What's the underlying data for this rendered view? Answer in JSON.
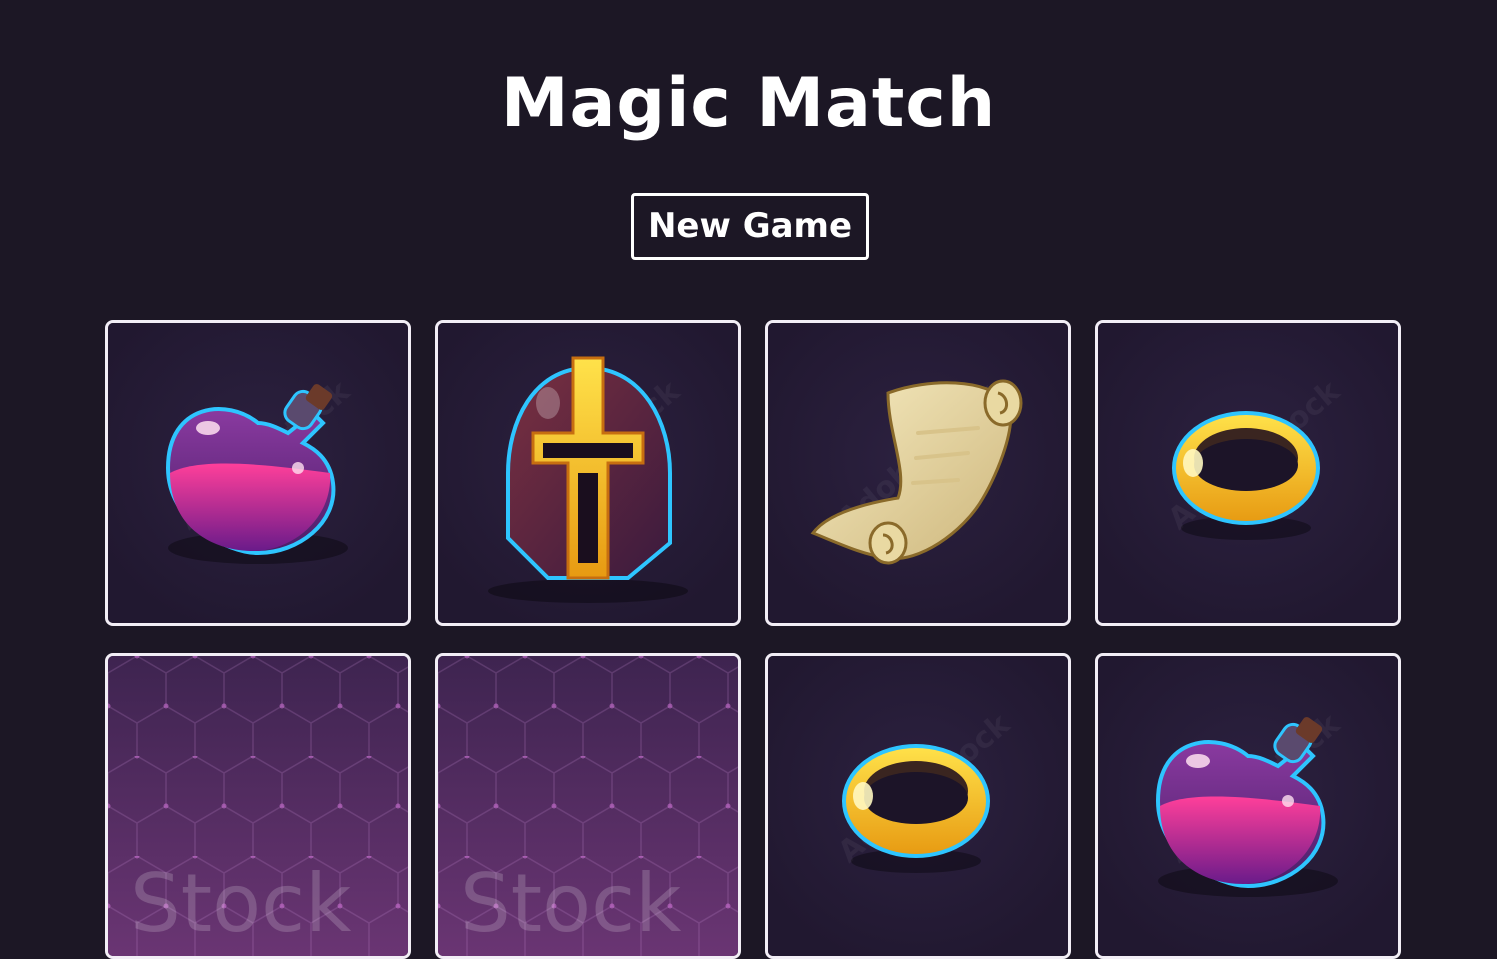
{
  "title": "Magic Match",
  "new_game_label": "New Game",
  "cards": [
    {
      "state": "face-up",
      "item": "potion-icon"
    },
    {
      "state": "face-up",
      "item": "helmet-icon"
    },
    {
      "state": "face-up",
      "item": "scroll-icon"
    },
    {
      "state": "face-up",
      "item": "ring-icon"
    },
    {
      "state": "face-down",
      "item": "card-back"
    },
    {
      "state": "face-down",
      "item": "card-back"
    },
    {
      "state": "face-up",
      "item": "ring-icon"
    },
    {
      "state": "face-up",
      "item": "potion-icon"
    }
  ],
  "card_back_text": "Stock",
  "colors": {
    "background": "#1c1725",
    "card_border": "#f2eef6",
    "card_face": "#241a33",
    "card_back": "#5b2f66"
  }
}
